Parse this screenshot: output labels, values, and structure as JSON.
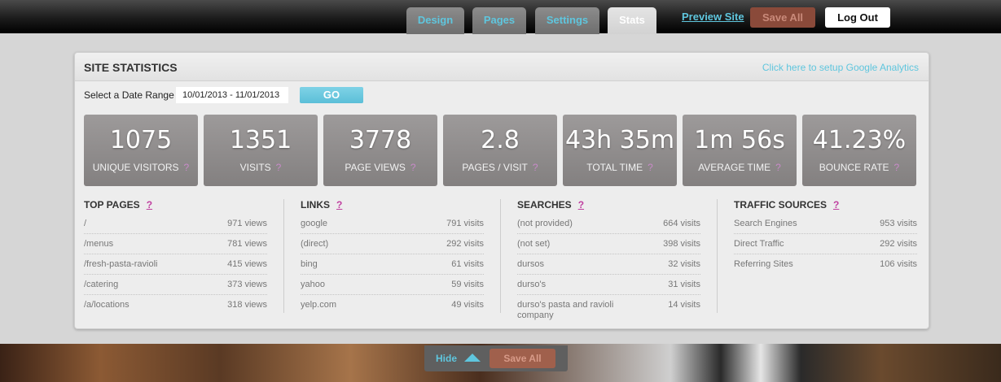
{
  "topbar": {
    "tabs": [
      {
        "label": "Design",
        "active": false
      },
      {
        "label": "Pages",
        "active": false
      },
      {
        "label": "Settings",
        "active": false
      },
      {
        "label": "Stats",
        "active": true
      }
    ],
    "preview_label": "Preview Site",
    "save_all_label": "Save All",
    "logout_label": "Log Out"
  },
  "panel": {
    "title": "SITE STATISTICS",
    "ga_link": "Click here to setup Google Analytics",
    "date_label": "Select a Date Range",
    "date_value": "10/01/2013 - 11/01/2013",
    "go_label": "GO",
    "stats": [
      {
        "value": "1075",
        "label": "UNIQUE VISITORS"
      },
      {
        "value": "1351",
        "label": "VISITS"
      },
      {
        "value": "3778",
        "label": "PAGE VIEWS"
      },
      {
        "value": "2.8",
        "label": "PAGES / VISIT"
      },
      {
        "value": "43h 35m",
        "label": "TOTAL TIME"
      },
      {
        "value": "1m 56s",
        "label": "AVERAGE TIME"
      },
      {
        "value": "41.23%",
        "label": "BOUNCE RATE"
      }
    ],
    "help_mark": "?",
    "columns": [
      {
        "title": "TOP PAGES",
        "rows": [
          {
            "name": "/",
            "value": "971 views"
          },
          {
            "name": "/menus",
            "value": "781 views"
          },
          {
            "name": "/fresh-pasta-ravioli",
            "value": "415 views"
          },
          {
            "name": "/catering",
            "value": "373 views"
          },
          {
            "name": "/a/locations",
            "value": "318 views"
          }
        ]
      },
      {
        "title": "LINKS",
        "rows": [
          {
            "name": "google",
            "value": "791 visits"
          },
          {
            "name": "(direct)",
            "value": "292 visits"
          },
          {
            "name": "bing",
            "value": "61 visits"
          },
          {
            "name": "yahoo",
            "value": "59 visits"
          },
          {
            "name": "yelp.com",
            "value": "49 visits"
          }
        ]
      },
      {
        "title": "SEARCHES",
        "rows": [
          {
            "name": "(not provided)",
            "value": "664 visits"
          },
          {
            "name": "(not set)",
            "value": "398 visits"
          },
          {
            "name": "dursos",
            "value": "32 visits"
          },
          {
            "name": "durso's",
            "value": "31 visits"
          },
          {
            "name": "durso's pasta and ravioli company",
            "value": "14 visits"
          }
        ]
      },
      {
        "title": "TRAFFIC SOURCES",
        "rows": [
          {
            "name": "Search Engines",
            "value": "953 visits"
          },
          {
            "name": "Direct Traffic",
            "value": "292 visits"
          },
          {
            "name": "Referring Sites",
            "value": "106 visits"
          }
        ]
      }
    ]
  },
  "bottom_bar": {
    "hide_label": "Hide",
    "toggle_icon": "triangle-up-icon",
    "save_all_label": "Save All"
  },
  "colors": {
    "accent": "#5fc6de",
    "save_button": "#8a4a3a",
    "stat_tile": "#8f8c8c",
    "help_mark": "#c040a0"
  }
}
